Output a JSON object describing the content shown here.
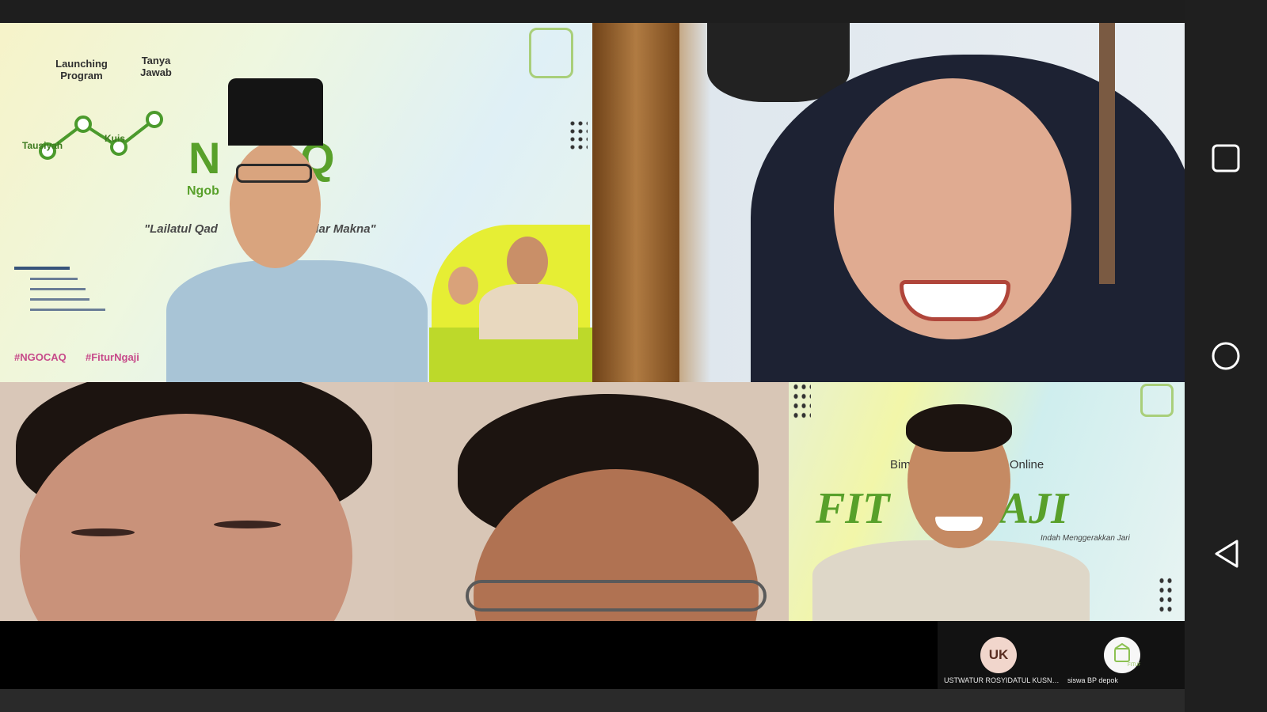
{
  "meeting": {
    "slide1": {
      "steps": [
        "Launching Program",
        "Tanya Jawab",
        "Tausiyah",
        "Kuis"
      ],
      "title_part": "N    AQ",
      "subtitle_part": "Ngob          atul Qadar",
      "tagline_part": "\"Lailatul Qad                    Sekedar Makna\"",
      "hashtags": [
        "#NGOCAQ",
        "#FiturNgaji"
      ]
    },
    "slide5": {
      "line1": "Bim                         an Online",
      "title": "FIT       GAJI",
      "tagline": "Indah Menggerakkan Jari"
    }
  },
  "participants": [
    {
      "initials": "UK",
      "name": "USTWATUR ROSYIDATUL KUSNIND..."
    },
    {
      "name": "siswa BP depok"
    }
  ],
  "nav": {
    "recent": "recent-apps-button",
    "home": "home-button",
    "back": "back-button"
  },
  "colors": {
    "accent_green": "#58a02a",
    "background": "#1f1f1f"
  }
}
